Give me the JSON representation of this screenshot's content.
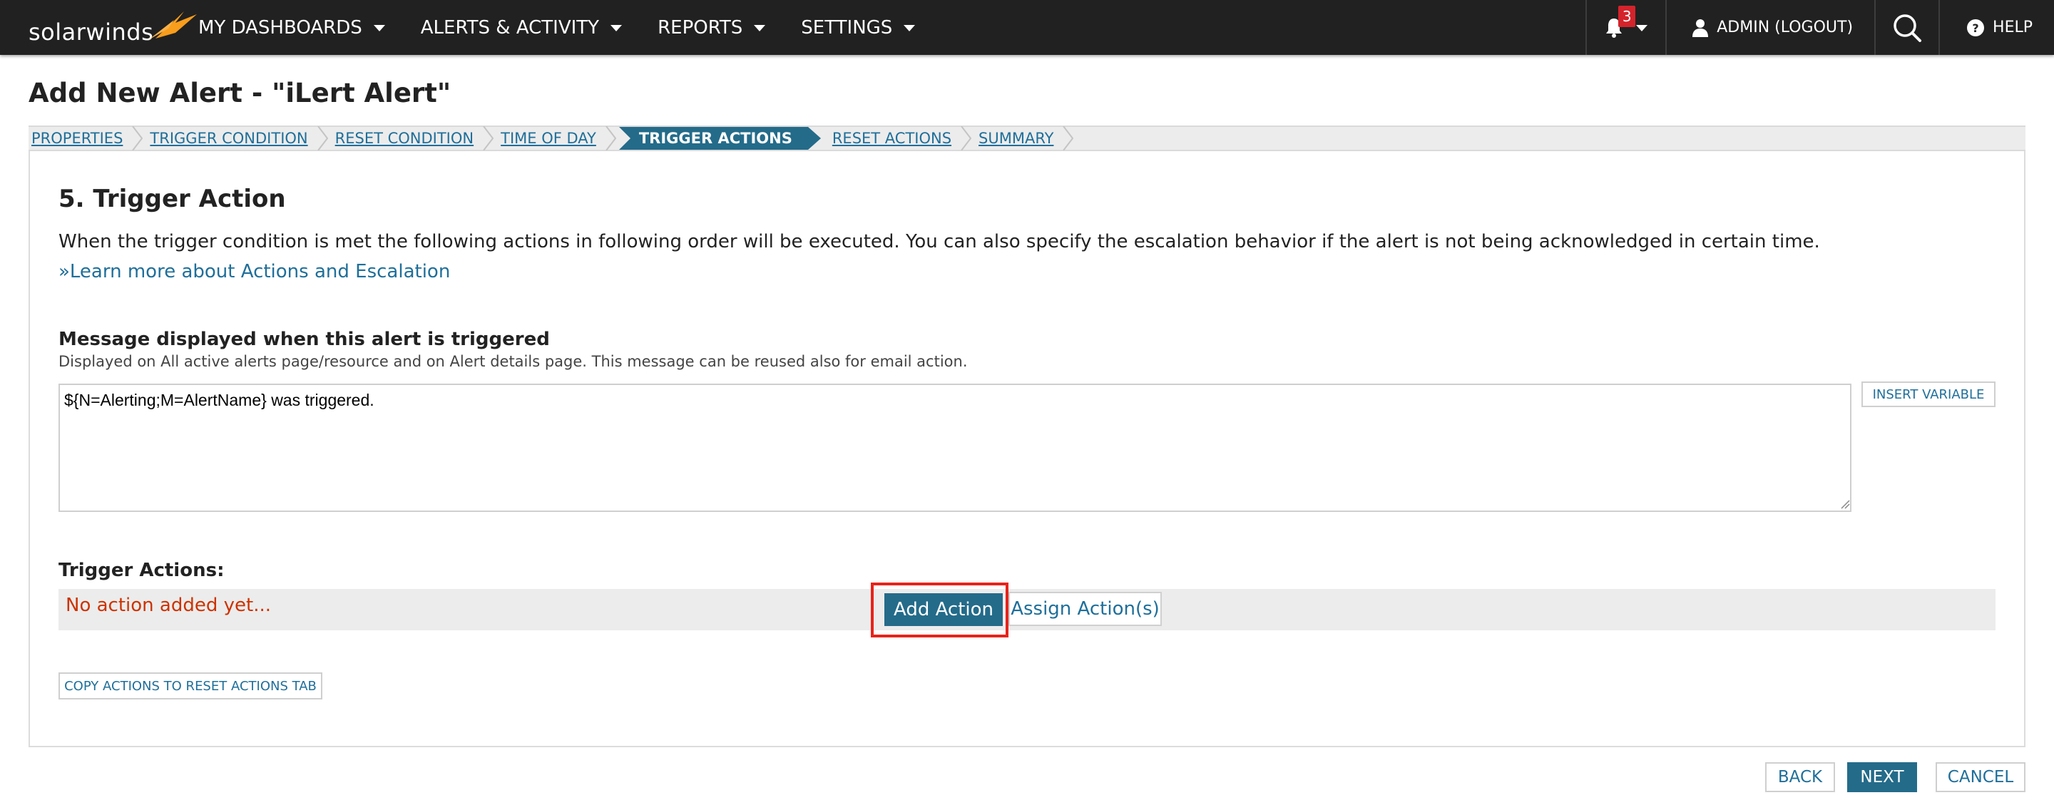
{
  "brand": {
    "logo_text": "solarwinds",
    "accent_color": "#246b8a",
    "logo_color": "#f99d1c"
  },
  "nav": {
    "items": [
      {
        "label": "MY DASHBOARDS"
      },
      {
        "label": "ALERTS & ACTIVITY"
      },
      {
        "label": "REPORTS"
      },
      {
        "label": "SETTINGS"
      }
    ],
    "notifications_count": "3",
    "user_label": "ADMIN (LOGOUT)",
    "help_label": "HELP",
    "icons": [
      "bell-icon",
      "user-icon",
      "search-icon",
      "help-icon"
    ]
  },
  "page": {
    "title": "Add New Alert - \"iLert Alert\""
  },
  "steps": [
    {
      "label": "PROPERTIES",
      "active": false
    },
    {
      "label": "TRIGGER CONDITION",
      "active": false
    },
    {
      "label": "RESET CONDITION",
      "active": false
    },
    {
      "label": "TIME OF DAY",
      "active": false
    },
    {
      "label": "TRIGGER ACTIONS",
      "active": true
    },
    {
      "label": "RESET ACTIONS",
      "active": false
    },
    {
      "label": "SUMMARY",
      "active": false
    }
  ],
  "section": {
    "title": "5. Trigger Action",
    "intro": "When the trigger condition is met the following actions in following order will be executed. You can also specify the escalation behavior if the alert is not being acknowledged in certain time.",
    "learn_more": "»Learn more about Actions and Escalation"
  },
  "message": {
    "label": "Message displayed when this alert is triggered",
    "help": "Displayed on All active alerts page/resource and on Alert details page. This message can be reused also for email action.",
    "value": "${N=Alerting;M=AlertName} was triggered.",
    "insert_variable": "INSERT VARIABLE"
  },
  "trigger_actions": {
    "label": "Trigger Actions:",
    "empty_text": "No action added yet...",
    "add_action": "Add Action",
    "assign_action": "Assign Action(s)",
    "copy_button": "COPY ACTIONS TO RESET ACTIONS TAB"
  },
  "footer": {
    "back": "BACK",
    "next": "NEXT",
    "cancel": "CANCEL"
  }
}
